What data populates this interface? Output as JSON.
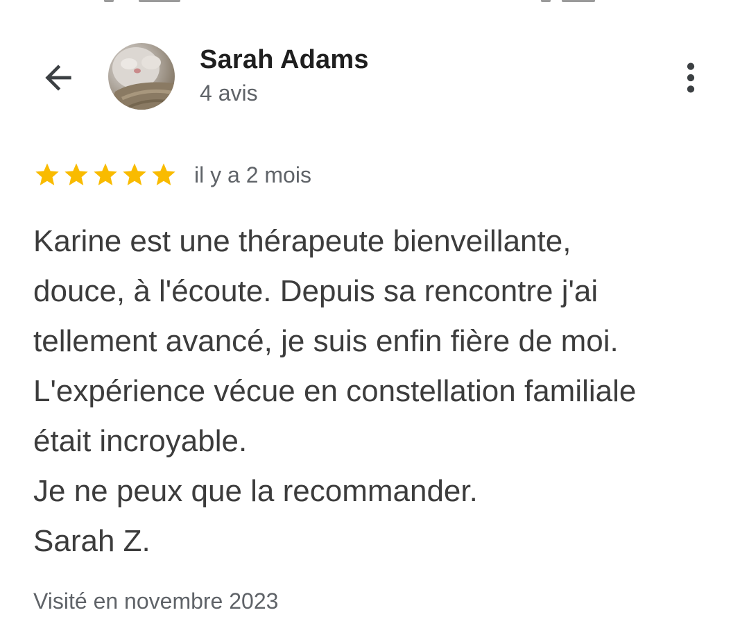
{
  "header": {
    "author_name": "Sarah Adams",
    "review_count": "4 avis",
    "icons": {
      "back": "arrow-back-icon",
      "more": "more-vert-icon"
    }
  },
  "review": {
    "rating": 5,
    "rating_max": 5,
    "star_color": "#f9bb00",
    "date": "il y a 2 mois",
    "lines": [
      "Karine est une thérapeute bienveillante,",
      "douce, à l'écoute. Depuis sa rencontre j'ai",
      "tellement avancé, je suis enfin fière de moi.",
      "L'expérience vécue en constellation familiale",
      "était incroyable.",
      "Je ne peux que la recommander.",
      "Sarah Z."
    ],
    "visit": "Visité en novembre 2023"
  }
}
